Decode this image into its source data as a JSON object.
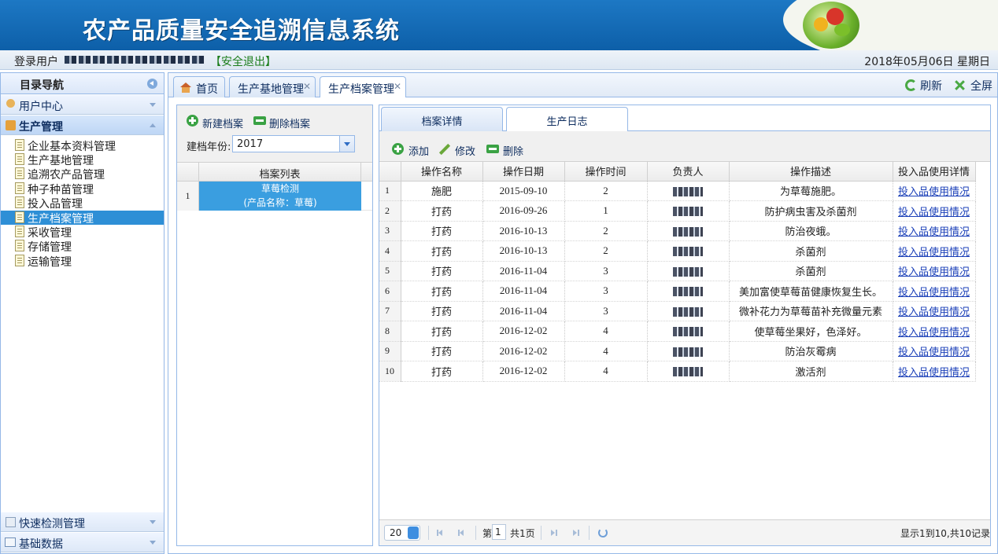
{
  "header": {
    "title": "农产品质量安全追溯信息系统"
  },
  "userbar": {
    "login_label": "登录用户",
    "logout_label": "【安全退出】",
    "date": "2018年05月06日 星期日"
  },
  "sidebar": {
    "title": "目录导航",
    "sections": [
      {
        "label": "用户中心"
      },
      {
        "label": "生产管理"
      },
      {
        "label": "快速检测管理"
      },
      {
        "label": "基础数据"
      }
    ],
    "items": [
      {
        "label": "企业基本资料管理"
      },
      {
        "label": "生产基地管理"
      },
      {
        "label": "追溯农产品管理"
      },
      {
        "label": "种子种苗管理"
      },
      {
        "label": "投入品管理"
      },
      {
        "label": "生产档案管理"
      },
      {
        "label": "采收管理"
      },
      {
        "label": "存储管理"
      },
      {
        "label": "运输管理"
      }
    ]
  },
  "tabs": [
    {
      "label": "首页"
    },
    {
      "label": "生产基地管理"
    },
    {
      "label": "生产档案管理"
    }
  ],
  "toolbar_right": {
    "refresh": "刷新",
    "fullscreen": "全屏"
  },
  "archive_panel": {
    "new_label": "新建档案",
    "delete_label": "删除档案",
    "year_label": "建档年份:",
    "year_value": "2017",
    "list_header": "档案列表",
    "rows": [
      {
        "num": "1",
        "line1": "草莓检测",
        "line2": "(产品名称：草莓)"
      }
    ]
  },
  "detail_tabs": [
    {
      "label": "档案详情"
    },
    {
      "label": "生产日志"
    }
  ],
  "log_toolbar": {
    "add": "添加",
    "edit": "修改",
    "delete": "删除"
  },
  "log_table": {
    "columns": [
      "操作名称",
      "操作日期",
      "操作时间",
      "负责人",
      "操作描述",
      "投入品使用详情"
    ],
    "rows": [
      {
        "num": "1",
        "name": "施肥",
        "date": "2015-09-10",
        "time": "2",
        "desc": "为草莓施肥。",
        "link": "投入品使用情况"
      },
      {
        "num": "2",
        "name": "打药",
        "date": "2016-09-26",
        "time": "1",
        "desc": "防护病虫害及杀菌剂",
        "link": "投入品使用情况"
      },
      {
        "num": "3",
        "name": "打药",
        "date": "2016-10-13",
        "time": "2",
        "desc": "防治夜蛾。",
        "link": "投入品使用情况"
      },
      {
        "num": "4",
        "name": "打药",
        "date": "2016-10-13",
        "time": "2",
        "desc": "杀菌剂",
        "link": "投入品使用情况"
      },
      {
        "num": "5",
        "name": "打药",
        "date": "2016-11-04",
        "time": "3",
        "desc": "杀菌剂",
        "link": "投入品使用情况"
      },
      {
        "num": "6",
        "name": "打药",
        "date": "2016-11-04",
        "time": "3",
        "desc": "美加富使草莓苗健康恢复生长。",
        "link": "投入品使用情况"
      },
      {
        "num": "7",
        "name": "打药",
        "date": "2016-11-04",
        "time": "3",
        "desc": "微补花力为草莓苗补充微量元素",
        "link": "投入品使用情况"
      },
      {
        "num": "8",
        "name": "打药",
        "date": "2016-12-02",
        "time": "4",
        "desc": "使草莓坐果好，色泽好。",
        "link": "投入品使用情况"
      },
      {
        "num": "9",
        "name": "打药",
        "date": "2016-12-02",
        "time": "4",
        "desc": "防治灰霉病",
        "link": "投入品使用情况"
      },
      {
        "num": "10",
        "name": "打药",
        "date": "2016-12-02",
        "time": "4",
        "desc": "激活剂",
        "link": "投入品使用情况"
      }
    ]
  },
  "pager": {
    "page_size": "20",
    "page_prefix": "第",
    "page_value": "1",
    "page_suffix": "共1页",
    "summary": "显示1到10,共10记录"
  }
}
